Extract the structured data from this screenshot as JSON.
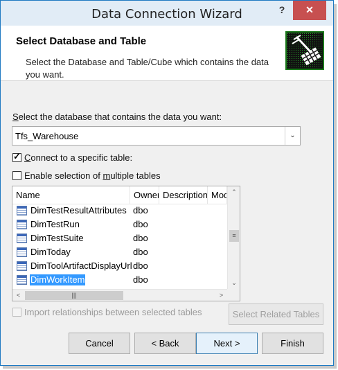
{
  "window": {
    "title": "Data Connection Wizard",
    "help_label": "?",
    "close_label": "✕"
  },
  "header": {
    "title": "Select Database and Table",
    "description": "Select the Database and Table/Cube which contains the data you want."
  },
  "database": {
    "label_prefix": "S",
    "label_rest": "elect the database that contains the data you want:",
    "value": "Tfs_Warehouse"
  },
  "connect_specific": {
    "checked": true,
    "prefix": "C",
    "label_rest": "onnect to a specific table:"
  },
  "enable_multiple": {
    "checked": false,
    "label_start": "Enable selection of ",
    "label_underlined": "m",
    "label_end": "ultiple tables"
  },
  "table_list": {
    "columns": [
      "Name",
      "Owner",
      "Description",
      "Mod"
    ],
    "rows": [
      {
        "name": "DimTestResultAttributes",
        "owner": "dbo",
        "selected": false
      },
      {
        "name": "DimTestRun",
        "owner": "dbo",
        "selected": false
      },
      {
        "name": "DimTestSuite",
        "owner": "dbo",
        "selected": false
      },
      {
        "name": "DimToday",
        "owner": "dbo",
        "selected": false
      },
      {
        "name": "DimToolArtifactDisplayUrl",
        "owner": "dbo",
        "selected": false
      },
      {
        "name": "DimWorkItem",
        "owner": "dbo",
        "selected": true
      }
    ]
  },
  "import_relationships": {
    "label": "Import relationships between selected tables",
    "enabled": false
  },
  "buttons": {
    "select_related": "Select Related Tables",
    "cancel": "Cancel",
    "back": "< Back",
    "next": "Next >",
    "finish": "Finish"
  },
  "colors": {
    "title_bar": "#e1ecf6",
    "close_button": "#c75050",
    "selection": "#3399ff"
  }
}
